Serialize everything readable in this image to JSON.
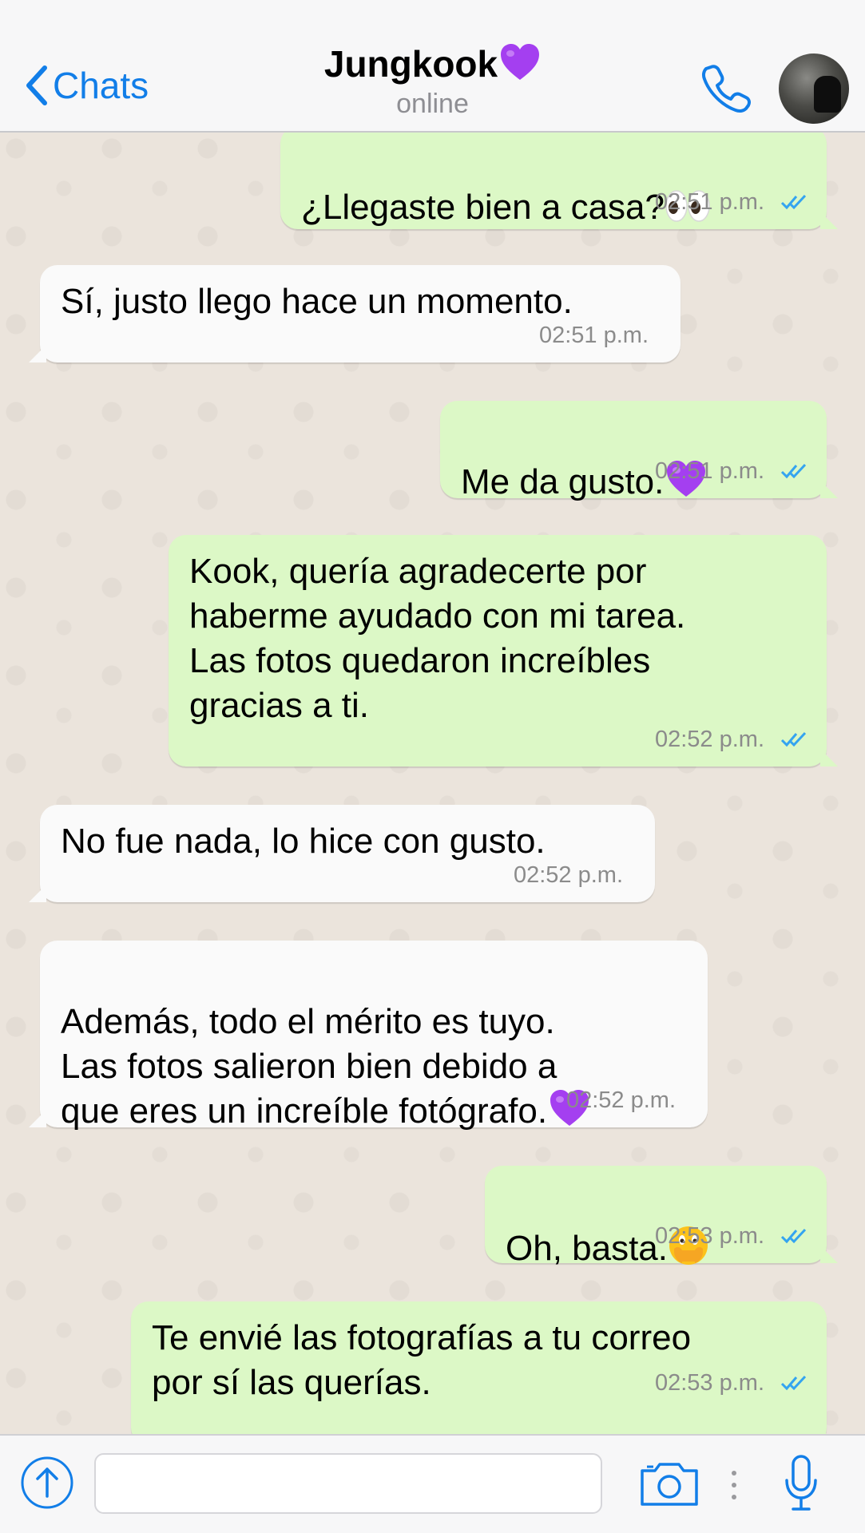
{
  "header": {
    "back_label": "Chats",
    "contact_name": "Jungkook",
    "status": "online"
  },
  "colors": {
    "accent": "#127ee8",
    "outgoing_bubble": "#dcf8c6",
    "incoming_bubble": "#fafafa",
    "read_ticks": "#34a4f0",
    "heart": "#a43ff0"
  },
  "messages": [
    {
      "direction": "out",
      "text": "¿Llegaste bien a casa?",
      "emoji": "eyes-emoji",
      "time": "02:51 p.m.",
      "ticks": "read"
    },
    {
      "direction": "in",
      "text": "Sí, justo llego hace un momento.",
      "time": "02:51 p.m."
    },
    {
      "direction": "out",
      "text": "Me da gusto.",
      "emoji": "purple-heart-emoji",
      "time": "02:51 p.m.",
      "ticks": "read"
    },
    {
      "direction": "out",
      "text": "Kook, quería agradecerte por\nhaberme ayudado con mi tarea.\nLas fotos quedaron increíbles\ngracias a ti.",
      "time": "02:52 p.m.",
      "ticks": "read"
    },
    {
      "direction": "in",
      "text": "No fue nada, lo hice con gusto.",
      "time": "02:52 p.m."
    },
    {
      "direction": "in",
      "text": "Además, todo el mérito es tuyo.\nLas fotos salieron bien debido a\nque eres un increíble fotógrafo.",
      "emoji": "purple-heart-emoji",
      "time": "02:52 p.m."
    },
    {
      "direction": "out",
      "text": "Oh, basta.",
      "emoji": "face-with-open-eyes-and-hand-over-mouth-emoji",
      "time": "02:53 p.m.",
      "ticks": "read"
    },
    {
      "direction": "out",
      "text": "Te envié las fotografías a tu correo\npor sí las querías.",
      "time": "02:53 p.m.",
      "ticks": "read"
    }
  ],
  "composer": {
    "value": "",
    "placeholder": ""
  },
  "icons": {
    "back": "chevron-left-icon",
    "call": "phone-icon",
    "attach": "upload-arrow-icon",
    "camera": "camera-icon",
    "more": "more-dots-icon",
    "mic": "microphone-icon"
  }
}
